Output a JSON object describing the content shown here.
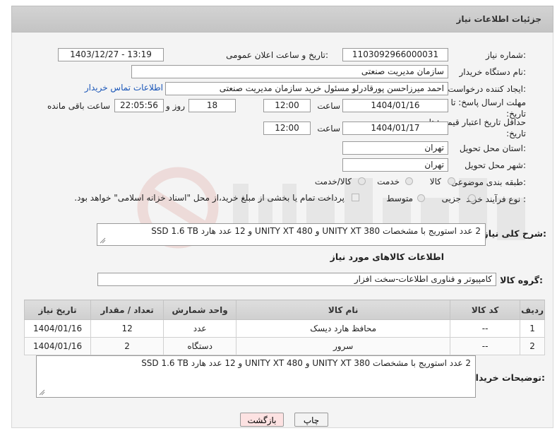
{
  "header": {
    "title": "جزئیات اطلاعات نیاز"
  },
  "form": {
    "need_number": {
      "label": "شماره نیاز:",
      "value": "1103092966000031"
    },
    "announce_datetime": {
      "label": "تاریخ و ساعت اعلان عمومی:",
      "value": "1403/12/27 - 13:19"
    },
    "buyer_org": {
      "label": "نام دستگاه خریدار:",
      "value": "سازمان مدیریت صنعتی"
    },
    "requester": {
      "label": "ایجاد کننده درخواست:",
      "value": "احمد میرزاحسن پورقادرلو مسئول خرید سازمان مدیریت صنعتی",
      "contact_link": "اطلاعات تماس خریدار"
    },
    "send_deadline": {
      "label": "مهلت ارسال پاسخ: تا تاریخ:",
      "date": "1404/01/16",
      "time_label": "ساعت",
      "time": "12:00",
      "days": "18",
      "days_label": "روز و",
      "remaining": "22:05:56",
      "remaining_label": "ساعت باقی مانده"
    },
    "validity": {
      "label": "حداقل تاریخ اعتبار قیمت: تا تاریخ:",
      "date": "1404/01/17",
      "time_label": "ساعت",
      "time": "12:00"
    },
    "province": {
      "label": "استان محل تحویل:",
      "value": "تهران"
    },
    "city": {
      "label": "شهر محل تحویل:",
      "value": "تهران"
    },
    "category": {
      "label": "طبقه بندی موضوعی:",
      "options": [
        "کالا",
        "خدمت",
        "کالا/خدمت"
      ]
    },
    "process": {
      "label": "نوع فرآیند خرید :",
      "options": [
        "جزیی",
        "متوسط"
      ],
      "note": "پرداخت تمام یا بخشی از مبلغ خرید،از محل \"اسناد خزانه اسلامی\" خواهد بود."
    },
    "summary": {
      "label": "شرح کلی نیاز:",
      "value": "2 عدد استوریج  با مشخصات UNITY XT 380 و UNITY XT 480 و 12 عدد هارد SSD 1.6 TB"
    }
  },
  "goods": {
    "section_title": "اطلاعات کالاهای مورد نیاز",
    "group_label": "گروه کالا:",
    "group_value": "کامپیوتر و فناوری اطلاعات-سخت افزار",
    "columns": [
      "ردیف",
      "کد کالا",
      "نام کالا",
      "واحد شمارش",
      "تعداد / مقدار",
      "تاریخ نیاز"
    ],
    "rows": [
      [
        "1",
        "--",
        "محافظ هارد دیسک",
        "عدد",
        "12",
        "1404/01/16"
      ],
      [
        "2",
        "--",
        "سرور",
        "دستگاه",
        "2",
        "1404/01/16"
      ]
    ]
  },
  "buyer_notes": {
    "label": "توضیحات خریدار:",
    "value": "2 عدد استوریج  با مشخصات UNITY XT 380 و UNITY XT 480 و 12 عدد هارد SSD 1.6 TB"
  },
  "buttons": {
    "print": "چاپ",
    "back": "بازگشت"
  },
  "colors": {
    "link": "#1a56b8",
    "back_button_bg": "#fde2e2",
    "header_bg": "#c8c8c8"
  }
}
